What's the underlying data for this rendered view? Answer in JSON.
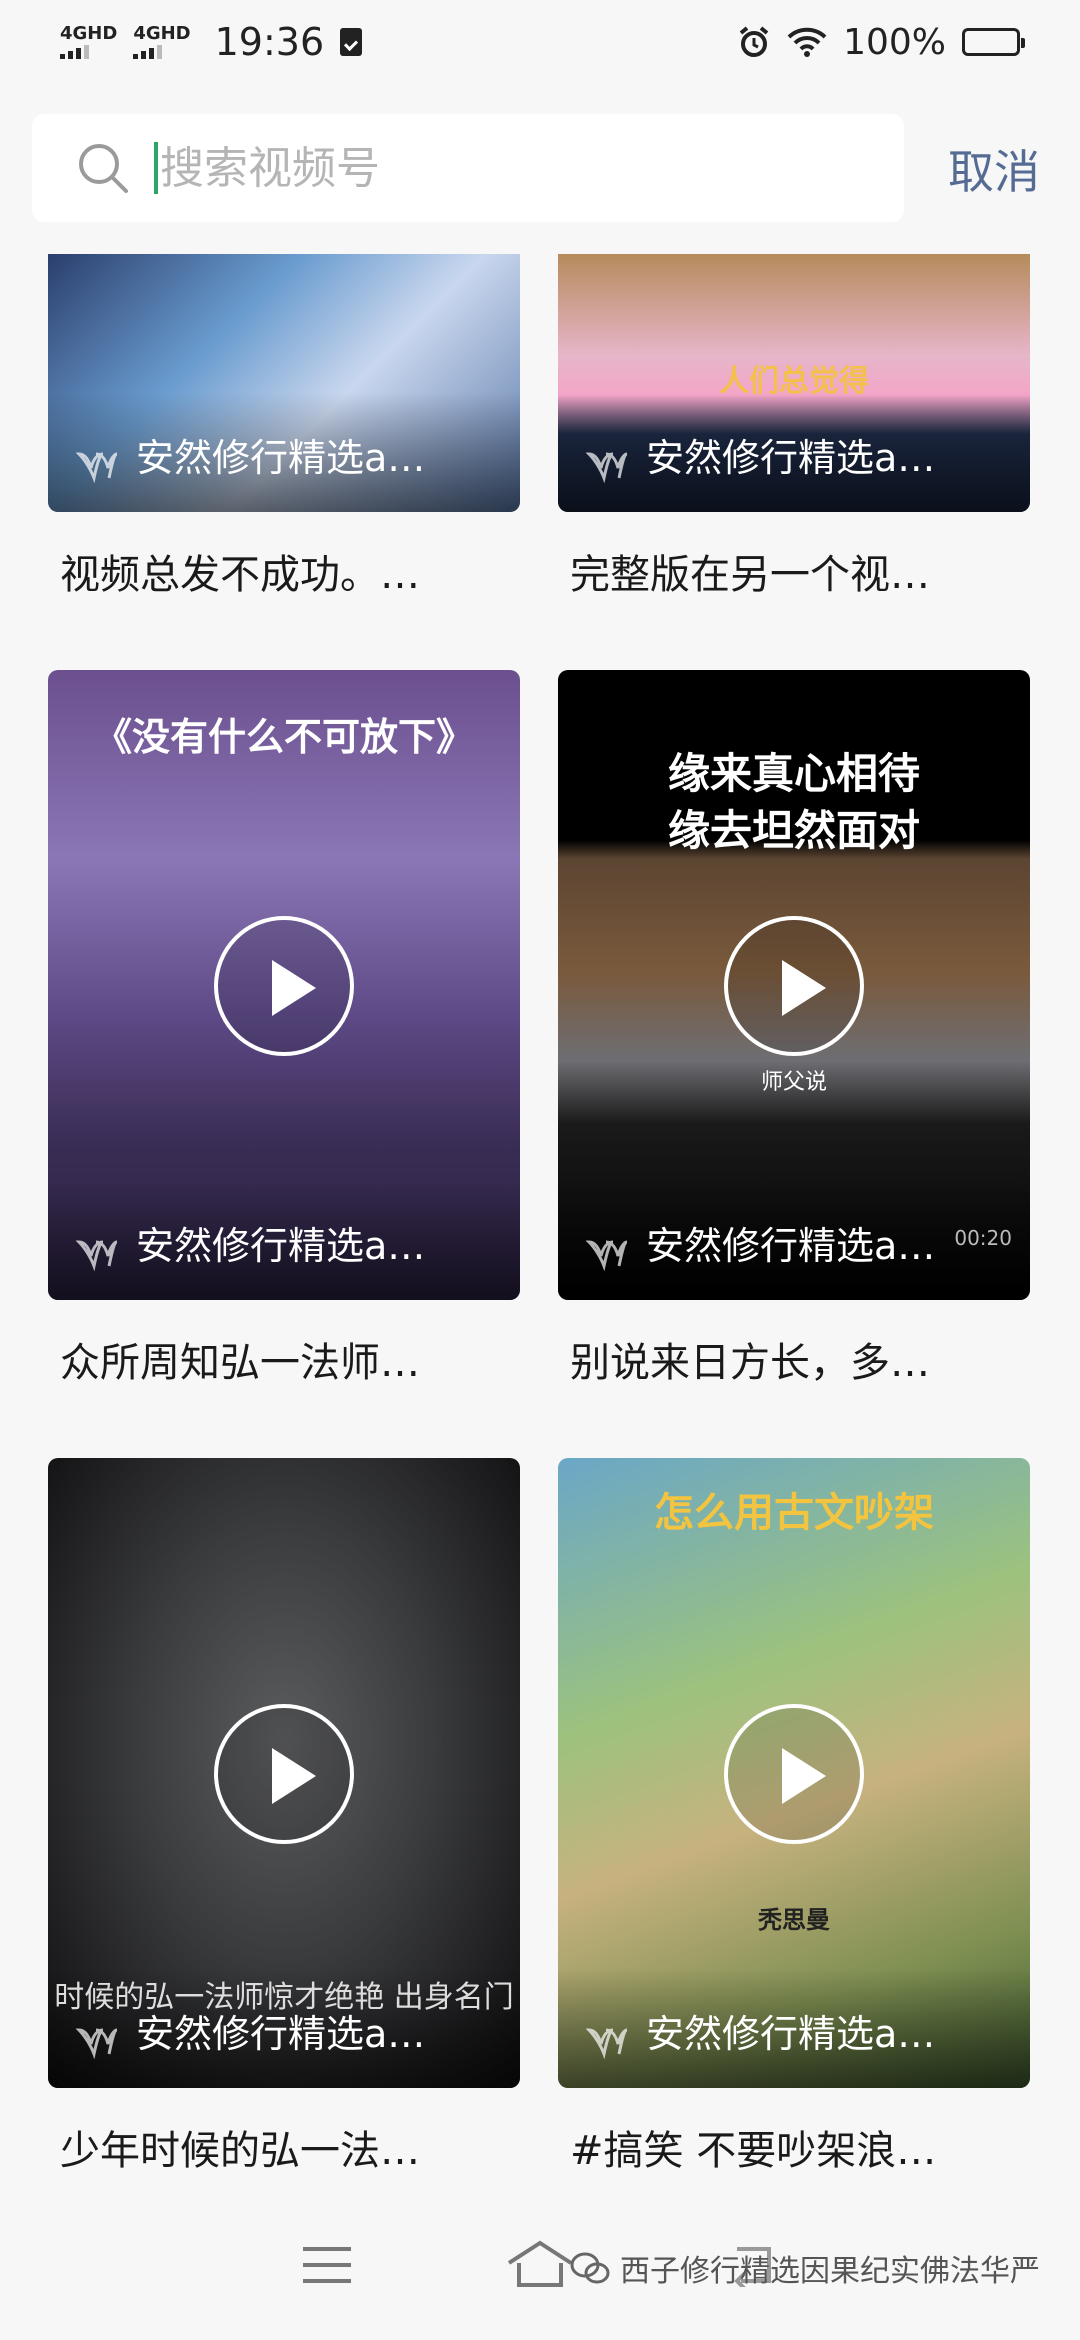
{
  "status_bar": {
    "net1": "4GHD",
    "net2": "4GHD",
    "time": "19:36",
    "battery": "100%"
  },
  "search": {
    "placeholder": "搜索视频号",
    "value": "",
    "cancel_label": "取消"
  },
  "videos": [
    {
      "author": "安然修行精选a…",
      "caption": "视频总发不成功。…",
      "banner": ""
    },
    {
      "author": "安然修行精选a…",
      "caption": "完整版在另一个视…",
      "banner": "人们总觉得"
    },
    {
      "author": "安然修行精选a…",
      "caption": "众所周知弘一法师…",
      "banner": "《没有什么不可放下》"
    },
    {
      "author": "安然修行精选a…",
      "caption": "别说来日方长，多…",
      "banner": "缘来真心相待\n缘去坦然面对",
      "sub": "师父说",
      "duration": "00:20"
    },
    {
      "author": "安然修行精选a…",
      "caption": "少年时候的弘一法…",
      "banner": "",
      "subtitle": "时候的弘一法师惊才绝艳 出身名门"
    },
    {
      "author": "安然修行精选a…",
      "caption": "#搞笑 不要吵架浪…",
      "banner": "怎么用古文吵架",
      "sub": "秃思曼"
    }
  ],
  "watermark": "西子修行精选因果纪实佛法华严",
  "colors": {
    "accent_cancel": "#566b94",
    "caret": "#2ca56a",
    "background": "#f7f7f7"
  }
}
